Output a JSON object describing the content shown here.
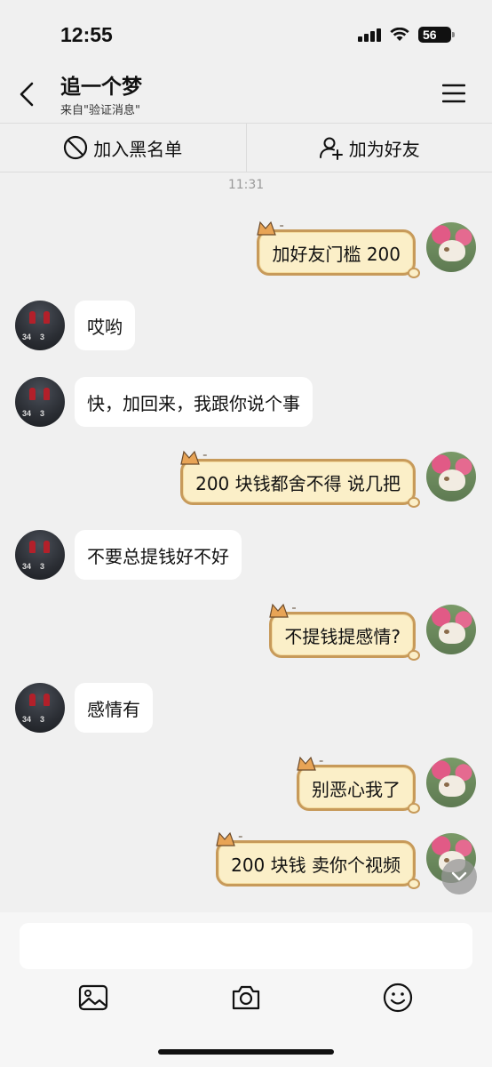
{
  "status_bar": {
    "time": "12:55",
    "battery": "56"
  },
  "header": {
    "title": "追一个梦",
    "subtitle": "来自\"验证消息\""
  },
  "actions": {
    "block_label": "加入黑名单",
    "add_friend_label": "加为好友"
  },
  "timestamp": "11:31",
  "messages": [
    {
      "side": "right",
      "text": "加好友门槛 200"
    },
    {
      "side": "left",
      "text": "哎哟"
    },
    {
      "side": "left",
      "text": "快，加回来，我跟你说个事"
    },
    {
      "side": "right",
      "text": "200 块钱都舍不得 说几把"
    },
    {
      "side": "left",
      "text": "不要总提钱好不好"
    },
    {
      "side": "right",
      "text": "不提钱提感情?"
    },
    {
      "side": "left",
      "text": "感情有"
    },
    {
      "side": "right",
      "text": "别恶心我了"
    },
    {
      "side": "right",
      "text": "200 块钱 卖你个视频"
    }
  ],
  "input": {
    "placeholder": ""
  },
  "colors": {
    "bubble_right_fill": "#fbefc8",
    "bubble_right_border": "#c79a5a",
    "background": "#f0f0f0"
  },
  "icons": [
    "back-arrow",
    "menu",
    "block",
    "add-user",
    "image",
    "camera",
    "emoji",
    "chevron-down",
    "signal",
    "wifi"
  ]
}
